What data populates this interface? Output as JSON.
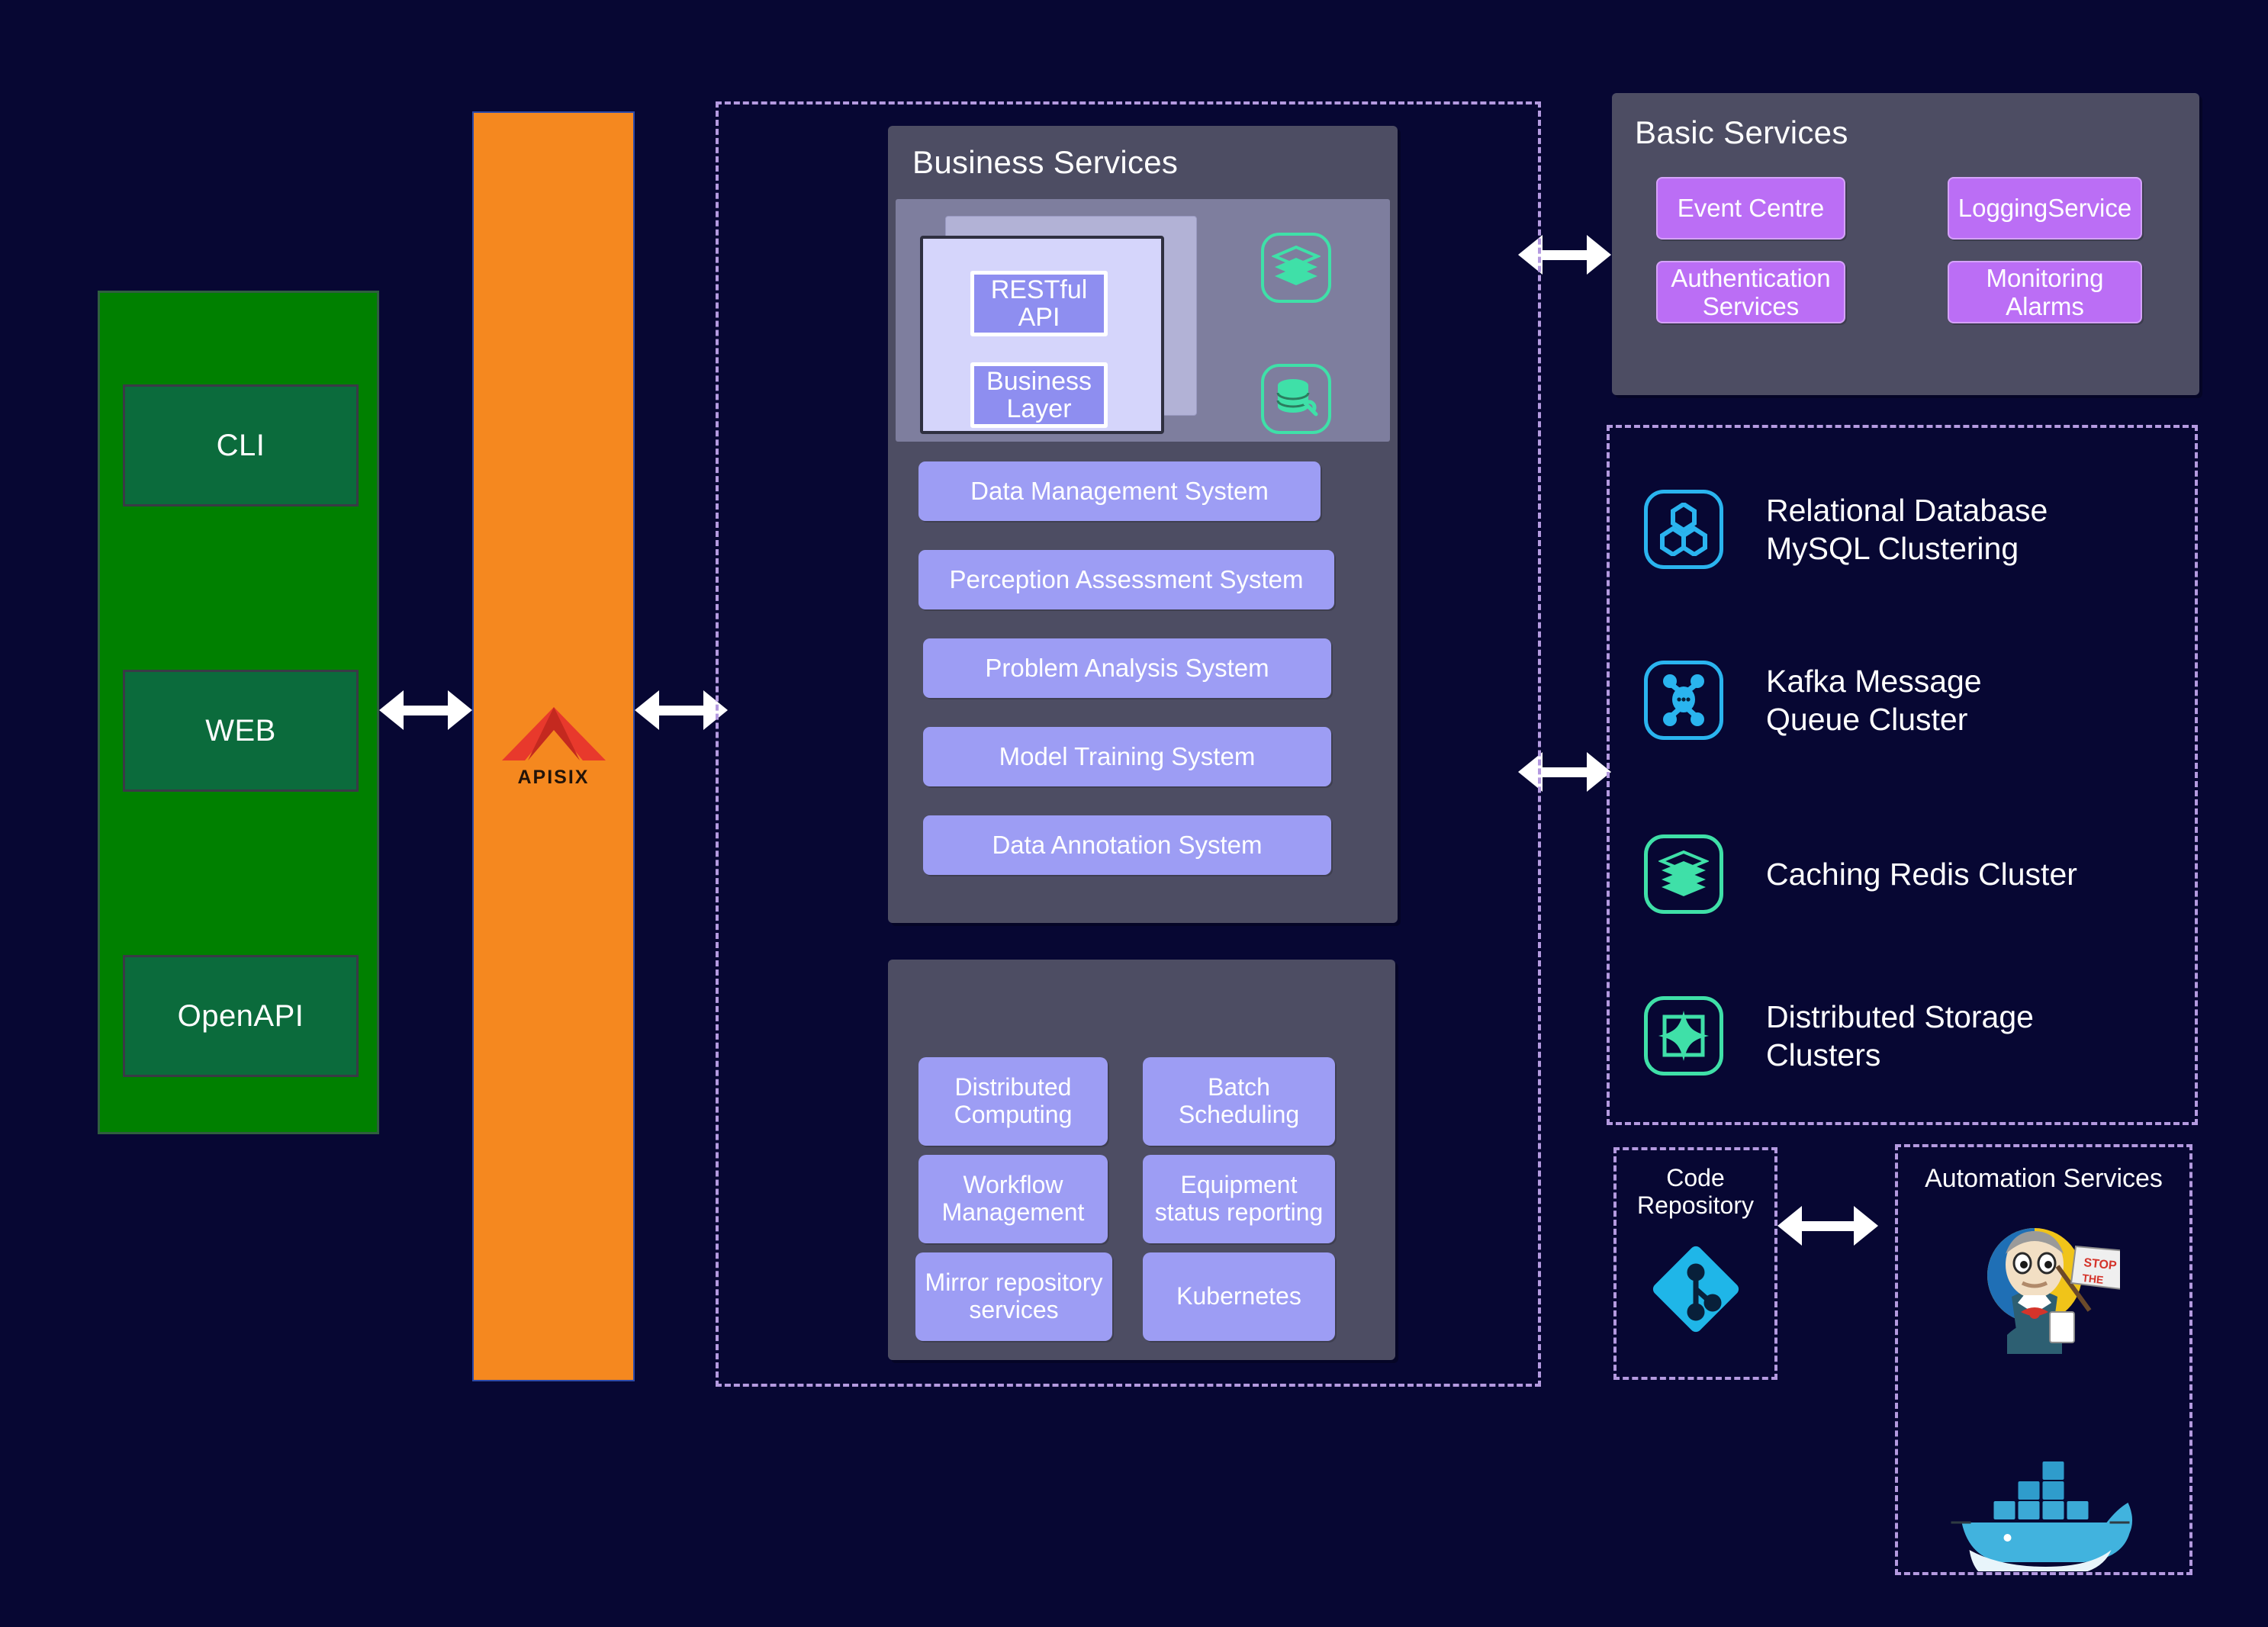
{
  "client": {
    "items": [
      {
        "label": "CLI"
      },
      {
        "label": "WEB"
      },
      {
        "label": "OpenAPI"
      }
    ]
  },
  "gateway": {
    "name": "APISIX",
    "icon": "apisix-logo-icon"
  },
  "business_services": {
    "title": "Business Services",
    "api_card": {
      "chips": [
        {
          "label": "RESTful\nAPI"
        },
        {
          "label": "Business\nLayer"
        }
      ]
    },
    "icons": [
      {
        "name": "stacked-layers-icon"
      },
      {
        "name": "database-wrench-icon"
      }
    ],
    "systems": [
      {
        "label": "Data Management System"
      },
      {
        "label": "Perception Assessment System"
      },
      {
        "label": "Problem Analysis System"
      },
      {
        "label": "Model Training System"
      },
      {
        "label": "Data Annotation System"
      }
    ]
  },
  "infrastructure": {
    "tiles": [
      {
        "label": "Distributed\nComputing"
      },
      {
        "label": "Batch\nScheduling"
      },
      {
        "label": "Workflow\nManagement"
      },
      {
        "label": "Equipment\nstatus reporting"
      },
      {
        "label": "Mirror repository\nservices"
      },
      {
        "label": "Kubernetes"
      }
    ]
  },
  "basic_services": {
    "title": "Basic Services",
    "chips": [
      {
        "label": "Event Centre"
      },
      {
        "label": "LoggingService"
      },
      {
        "label": "Authentication\nServices"
      },
      {
        "label": "Monitoring\nAlarms"
      }
    ]
  },
  "data_infrastructure": {
    "rows": [
      {
        "label": "Relational Database\nMySQL Clustering",
        "icon": "mysql-hexagons-icon",
        "color": "#2ab4ef"
      },
      {
        "label": "Kafka Message\nQueue Cluster",
        "icon": "kafka-nodes-icon",
        "color": "#2ab4ef"
      },
      {
        "label": "Caching Redis Cluster",
        "icon": "redis-stack-icon",
        "color": "#3fe0a8"
      },
      {
        "label": "Distributed Storage\nClusters",
        "icon": "distributed-storage-icon",
        "color": "#3fe0a8"
      }
    ]
  },
  "code_repository": {
    "title": "Code\nRepository",
    "icon": "git-logo-icon"
  },
  "automation_services": {
    "title": "Automation Services",
    "icons": [
      {
        "name": "jenkins-butler-icon"
      },
      {
        "name": "docker-whale-icon"
      }
    ]
  },
  "connectors": [
    {
      "name": "arrow-client-gateway",
      "type": "bidirectional"
    },
    {
      "name": "arrow-gateway-business",
      "type": "bidirectional"
    },
    {
      "name": "arrow-business-basic",
      "type": "bidirectional"
    },
    {
      "name": "arrow-business-data",
      "type": "bidirectional"
    },
    {
      "name": "arrow-code-automation",
      "type": "bidirectional"
    }
  ],
  "colors": {
    "background": "#070733",
    "client_panel": "#008000",
    "client_box": "#0b6b3c",
    "gateway": "#f5881f",
    "panel": "#4d4d63",
    "chip_purple": "#9d9df4",
    "chip_magenta": "#bb6ef5",
    "dashed_border": "#b49ae0",
    "icon_cyan": "#2ab4ef",
    "icon_green": "#3fe0a8"
  }
}
